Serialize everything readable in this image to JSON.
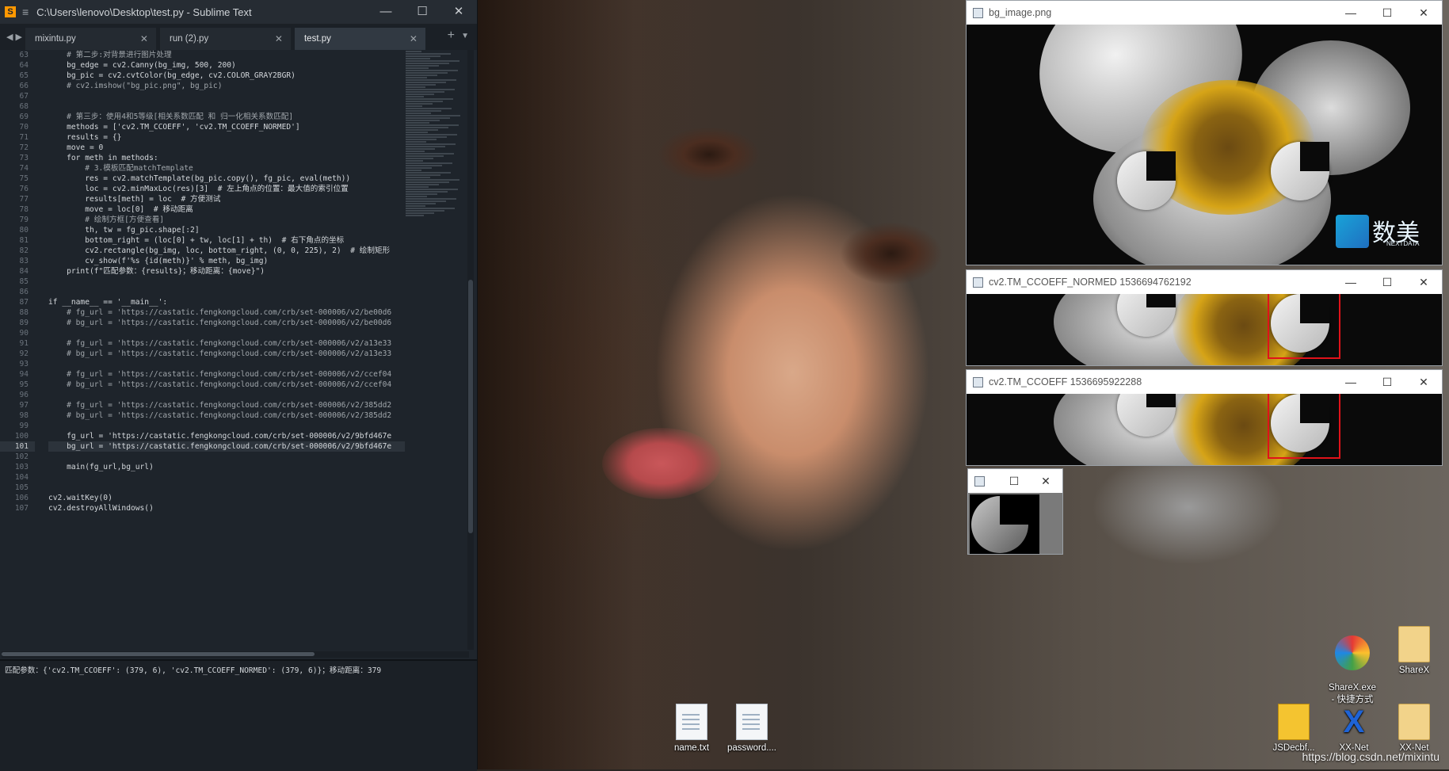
{
  "sublime": {
    "title": "C:\\Users\\lenovo\\Desktop\\test.py - Sublime Text",
    "tabs": [
      {
        "label": "mixintu.py",
        "active": false
      },
      {
        "label": "run (2).py",
        "active": false
      },
      {
        "label": "test.py",
        "active": true
      }
    ],
    "lines": [
      {
        "n": "63",
        "t": "    # 第二步:对背景进行图片处理"
      },
      {
        "n": "64",
        "t": "    bg_edge = cv2.Canny(bg_img, 500, 200)"
      },
      {
        "n": "65",
        "t": "    bg_pic = cv2.cvtColor(bg_edge, cv2.COLOR_GRAY2BGR)"
      },
      {
        "n": "66",
        "t": "    # cv2.imshow(\"bg_pic.png\", bg_pic)"
      },
      {
        "n": "67",
        "t": ""
      },
      {
        "n": "68",
        "t": ""
      },
      {
        "n": "69",
        "t": "    # 第三步：使用4和5等级[相关系数匹配 和 归一化相关系数匹配]"
      },
      {
        "n": "70",
        "t": "    methods = ['cv2.TM_CCOEFF', 'cv2.TM_CCOEFF_NORMED']"
      },
      {
        "n": "71",
        "t": "    results = {}"
      },
      {
        "n": "72",
        "t": "    move = 0"
      },
      {
        "n": "73",
        "t": "    for meth in methods:"
      },
      {
        "n": "74",
        "t": "        # 3.模板匹配matchTemplate"
      },
      {
        "n": "75",
        "t": "        res = cv2.matchTemplate(bg_pic.copy(), fg_pic, eval(meth))"
      },
      {
        "n": "76",
        "t": "        loc = cv2.minMaxLoc(res)[3]  # 左上角点的位置：最大值的索引位置"
      },
      {
        "n": "77",
        "t": "        results[meth] = loc  # 方便测试"
      },
      {
        "n": "78",
        "t": "        move = loc[0]  # 移动距离"
      },
      {
        "n": "79",
        "t": "        # 绘制方框[方便查看]"
      },
      {
        "n": "80",
        "t": "        th, tw = fg_pic.shape[:2]"
      },
      {
        "n": "81",
        "t": "        bottom_right = (loc[0] + tw, loc[1] + th)  # 右下角点的坐标"
      },
      {
        "n": "82",
        "t": "        cv2.rectangle(bg_img, loc, bottom_right, (0, 0, 225), 2)  # 绘制矩形"
      },
      {
        "n": "83",
        "t": "        cv_show(f'%s {id(meth)}' % meth, bg_img)"
      },
      {
        "n": "84",
        "t": "    print(f\"匹配参数：{results}；移动距离：{move}\")"
      },
      {
        "n": "85",
        "t": ""
      },
      {
        "n": "86",
        "t": ""
      },
      {
        "n": "87",
        "t": "if __name__ == '__main__':"
      },
      {
        "n": "88",
        "t": "    # fg_url = 'https://castatic.fengkongcloud.com/crb/set-000006/v2/be00d6"
      },
      {
        "n": "89",
        "t": "    # bg_url = 'https://castatic.fengkongcloud.com/crb/set-000006/v2/be00d6"
      },
      {
        "n": "90",
        "t": ""
      },
      {
        "n": "91",
        "t": "    # fg_url = 'https://castatic.fengkongcloud.com/crb/set-000006/v2/a13e33"
      },
      {
        "n": "92",
        "t": "    # bg_url = 'https://castatic.fengkongcloud.com/crb/set-000006/v2/a13e33"
      },
      {
        "n": "93",
        "t": ""
      },
      {
        "n": "94",
        "t": "    # fg_url = 'https://castatic.fengkongcloud.com/crb/set-000006/v2/ccef04"
      },
      {
        "n": "95",
        "t": "    # bg_url = 'https://castatic.fengkongcloud.com/crb/set-000006/v2/ccef04"
      },
      {
        "n": "96",
        "t": ""
      },
      {
        "n": "97",
        "t": "    # fg_url = 'https://castatic.fengkongcloud.com/crb/set-000006/v2/385dd2"
      },
      {
        "n": "98",
        "t": "    # bg_url = 'https://castatic.fengkongcloud.com/crb/set-000006/v2/385dd2"
      },
      {
        "n": "99",
        "t": ""
      },
      {
        "n": "100",
        "t": "    fg_url = 'https://castatic.fengkongcloud.com/crb/set-000006/v2/9bfd467e"
      },
      {
        "n": "101",
        "t": "    bg_url = 'https://castatic.fengkongcloud.com/crb/set-000006/v2/9bfd467e",
        "current": true
      },
      {
        "n": "102",
        "t": ""
      },
      {
        "n": "103",
        "t": "    main(fg_url,bg_url)"
      },
      {
        "n": "104",
        "t": ""
      },
      {
        "n": "105",
        "t": ""
      },
      {
        "n": "106",
        "t": "cv2.waitKey(0)"
      },
      {
        "n": "107",
        "t": "cv2.destroyAllWindows()"
      }
    ],
    "console_output": "匹配参数：{'cv2.TM_CCOEFF': (379, 6), 'cv2.TM_CCOEFF_NORMED': (379, 6)}；移动距离：379"
  },
  "cv_windows": {
    "bg": {
      "title": "bg_image.png"
    },
    "normed": {
      "title": "cv2.TM_CCOEFF_NORMED 1536694762192"
    },
    "ccoeff": {
      "title": "cv2.TM_CCOEFF 1536695922288"
    },
    "small": {
      "title": ""
    }
  },
  "bg_image_logo": {
    "text": "数美",
    "sub": "NEXTDATA"
  },
  "window_controls": {
    "minimize": "—",
    "maximize": "☐",
    "close": "✕"
  },
  "desktop_icons": [
    {
      "label": "name.txt",
      "type": "doc"
    },
    {
      "label": "password....",
      "type": "doc"
    },
    {
      "label": "ShareX.exe\n- 快捷方式",
      "type": "app"
    },
    {
      "label": "ShareX",
      "type": "folder"
    },
    {
      "label": "JSDecbf...",
      "type": "app"
    },
    {
      "label": "XX-Net",
      "type": "app"
    },
    {
      "label": "XX-Net",
      "type": "folder"
    }
  ],
  "watermark": "https://blog.csdn.net/mixintu",
  "colors": {
    "red_box": "#e0121a",
    "sublime_bg": "#1e242b"
  }
}
